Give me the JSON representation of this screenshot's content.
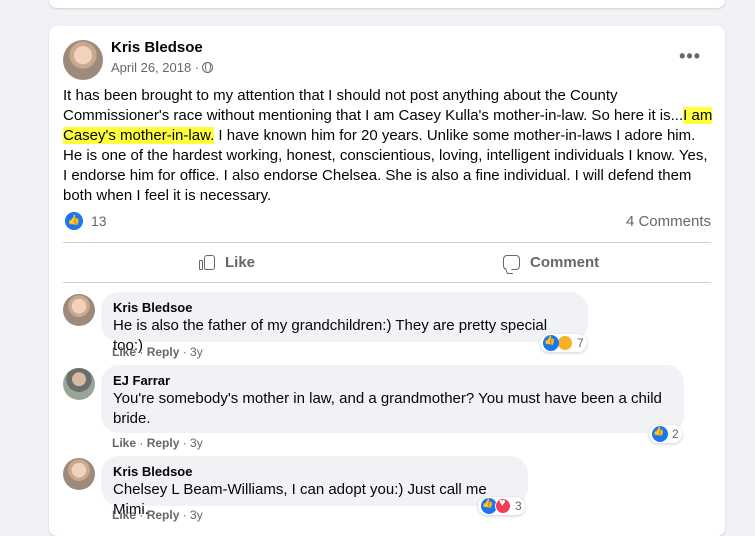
{
  "post": {
    "author": "Kris Bledsoe",
    "date": "April 26, 2018 ·",
    "body_before": "It has been brought to my attention that I should not post anything about the County Commissioner's race without mentioning that I am Casey Kulla's mother-in-law. So here it is...",
    "body_highlight": "I am Casey's mother-in-law.",
    "body_after": " I have known him for 20 years. Unlike some mother-in-laws I adore him. He is one of the hardest working, honest, conscientious, loving, intelligent individuals I know. Yes, I endorse him for office. I also endorse Chelsea. She is also a fine individual. I will defend them both when I feel it is necessary.",
    "like_count": "13",
    "comment_count": "4 Comments",
    "like_label": "Like",
    "comment_label": "Comment",
    "icons": [
      "globe-icon",
      "more-icon",
      "thumb-up-icon",
      "comment-icon"
    ]
  },
  "comments": [
    {
      "author": "Kris Bledsoe",
      "text": "He is also the father of my grandchildren:) They are pretty special too:)",
      "like": "Like",
      "reply": "Reply",
      "age": "3y",
      "reaction_count": "7"
    },
    {
      "author": "EJ Farrar",
      "text": "You're somebody's mother in law, and a grandmother? You must have been a child bride.",
      "like": "Like",
      "reply": "Reply",
      "age": "3y",
      "reaction_count": "2"
    },
    {
      "author": "Kris Bledsoe",
      "text": "Chelsey L Beam-Williams, I can adopt you:) Just call me Mimi.",
      "like": "Like",
      "reply": "Reply",
      "age": "3y",
      "reaction_count": "3"
    }
  ],
  "colors": {
    "highlight": "#ffff3c",
    "like_blue": "#1877f2",
    "secondary_text": "#65676b"
  }
}
